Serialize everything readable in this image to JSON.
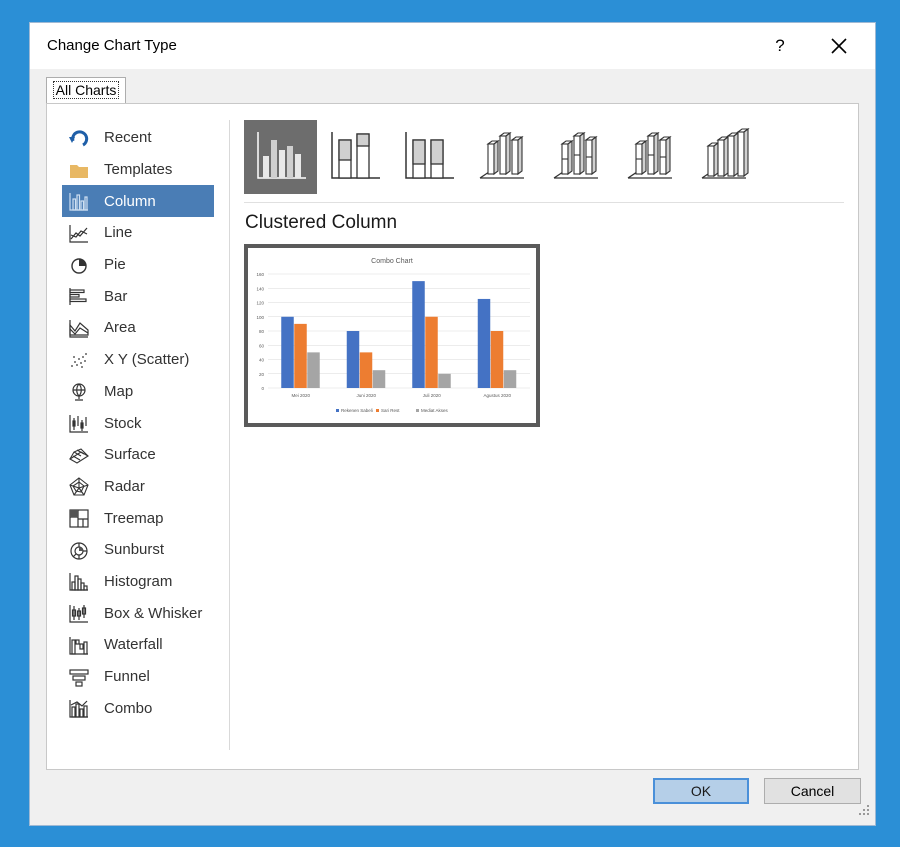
{
  "dialog": {
    "title": "Change Chart Type",
    "help_label": "?",
    "tabs": [
      {
        "label": "All Charts"
      }
    ],
    "ok_label": "OK",
    "cancel_label": "Cancel"
  },
  "sidebar": {
    "items": [
      {
        "label": "Recent",
        "icon": "recent-icon"
      },
      {
        "label": "Templates",
        "icon": "templates-folder-icon"
      },
      {
        "label": "Column",
        "icon": "column-chart-icon",
        "selected": true
      },
      {
        "label": "Line",
        "icon": "line-chart-icon"
      },
      {
        "label": "Pie",
        "icon": "pie-chart-icon"
      },
      {
        "label": "Bar",
        "icon": "bar-chart-icon"
      },
      {
        "label": "Area",
        "icon": "area-chart-icon"
      },
      {
        "label": "X Y (Scatter)",
        "icon": "scatter-chart-icon"
      },
      {
        "label": "Map",
        "icon": "map-chart-icon"
      },
      {
        "label": "Stock",
        "icon": "stock-chart-icon"
      },
      {
        "label": "Surface",
        "icon": "surface-chart-icon"
      },
      {
        "label": "Radar",
        "icon": "radar-chart-icon"
      },
      {
        "label": "Treemap",
        "icon": "treemap-chart-icon"
      },
      {
        "label": "Sunburst",
        "icon": "sunburst-chart-icon"
      },
      {
        "label": "Histogram",
        "icon": "histogram-chart-icon"
      },
      {
        "label": "Box & Whisker",
        "icon": "box-whisker-chart-icon"
      },
      {
        "label": "Waterfall",
        "icon": "waterfall-chart-icon"
      },
      {
        "label": "Funnel",
        "icon": "funnel-chart-icon"
      },
      {
        "label": "Combo",
        "icon": "combo-chart-icon"
      }
    ]
  },
  "variants": [
    {
      "icon": "clustered-column-icon",
      "selected": true
    },
    {
      "icon": "stacked-column-icon"
    },
    {
      "icon": "100-stacked-column-icon"
    },
    {
      "icon": "3d-clustered-column-icon"
    },
    {
      "icon": "3d-stacked-column-icon"
    },
    {
      "icon": "3d-100-stacked-column-icon"
    },
    {
      "icon": "3d-column-icon"
    }
  ],
  "selected_chart_name": "Clustered Column",
  "colors": {
    "accent": "#4a7db5",
    "series1": "#4472c4",
    "series2": "#ed7d31",
    "series3": "#a5a5a5"
  },
  "chart_data": {
    "type": "bar",
    "title": "Combo Chart",
    "categories": [
      "Mei 2020",
      "Juni 2020",
      "Juli 2020",
      "Agustus 2020"
    ],
    "series": [
      {
        "name": "Rekenen Sabeli",
        "values": [
          100,
          80,
          150,
          125
        ]
      },
      {
        "name": "Sari Rest",
        "values": [
          90,
          50,
          100,
          80
        ]
      },
      {
        "name": "Mediat Akses",
        "values": [
          50,
          25,
          20,
          25
        ]
      }
    ],
    "ylim": [
      0,
      160
    ],
    "yticks": [
      "0",
      "20",
      "40",
      "60",
      "80",
      "100",
      "120",
      "140",
      "160"
    ],
    "grid": true,
    "legend": "bottom"
  }
}
